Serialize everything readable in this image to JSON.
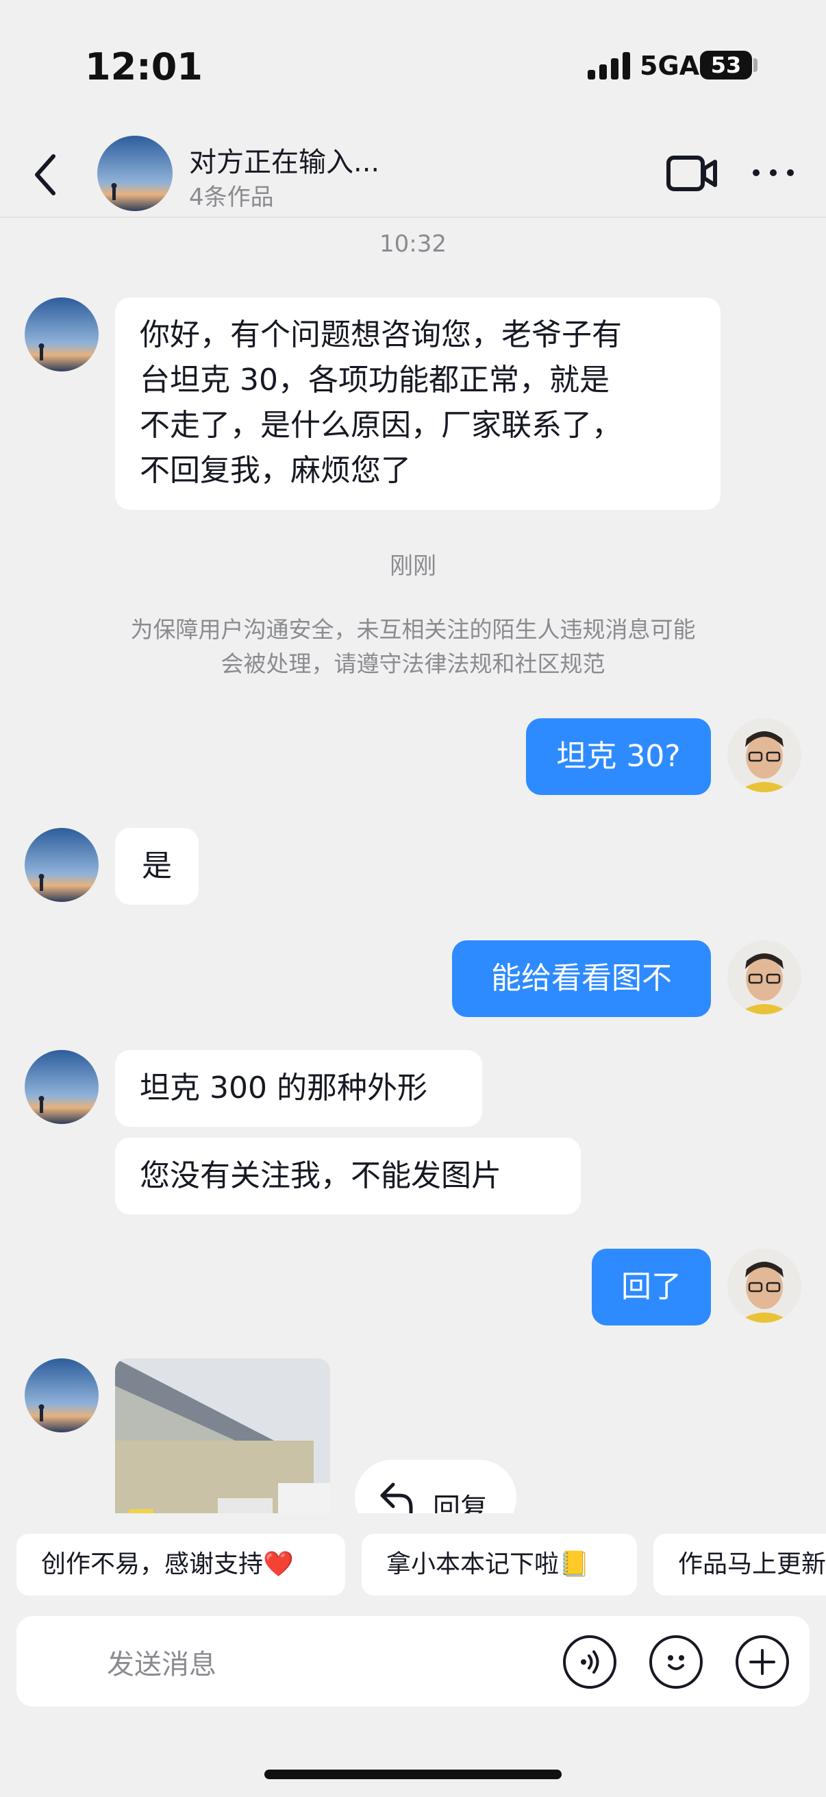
{
  "status_bar": {
    "time": "12:01",
    "network": "5GA",
    "battery": "53"
  },
  "header": {
    "name": "对方正在输入...",
    "subtitle": "4条作品",
    "icons": [
      "back-arrow-icon",
      "video-call-icon",
      "more-icon"
    ]
  },
  "chat": {
    "timestamp_1": "10:32",
    "msg_1": [
      "你好，有个问题想咨询您，老爷子有",
      "台坦克 30，各项功能都正常，就是",
      "不走了，是什么原因，厂家联系了，",
      "不回复我，麻烦您了"
    ],
    "timestamp_2": "刚刚",
    "notice": [
      "为保障用户沟通安全，未互相关注的陌生人违规消息可能",
      "会被处理，请遵守法律法规和社区规范"
    ],
    "msg_2": "坦克 30?",
    "msg_3": "是",
    "msg_4": "能给看看图不",
    "msg_5": "坦克 300 的那种外形",
    "msg_6": "您没有关注我，不能发图片",
    "msg_7": "回了",
    "reply_label": "回复"
  },
  "quick_replies": [
    "创作不易，感谢支持❤️",
    "拿小本本记下啦📒",
    "作品马上更新"
  ],
  "input": {
    "placeholder": "发送消息"
  },
  "colors": {
    "bubble_out": "#2e8bff",
    "background": "#f0f0f0",
    "bubble_in": "#ffffff"
  }
}
